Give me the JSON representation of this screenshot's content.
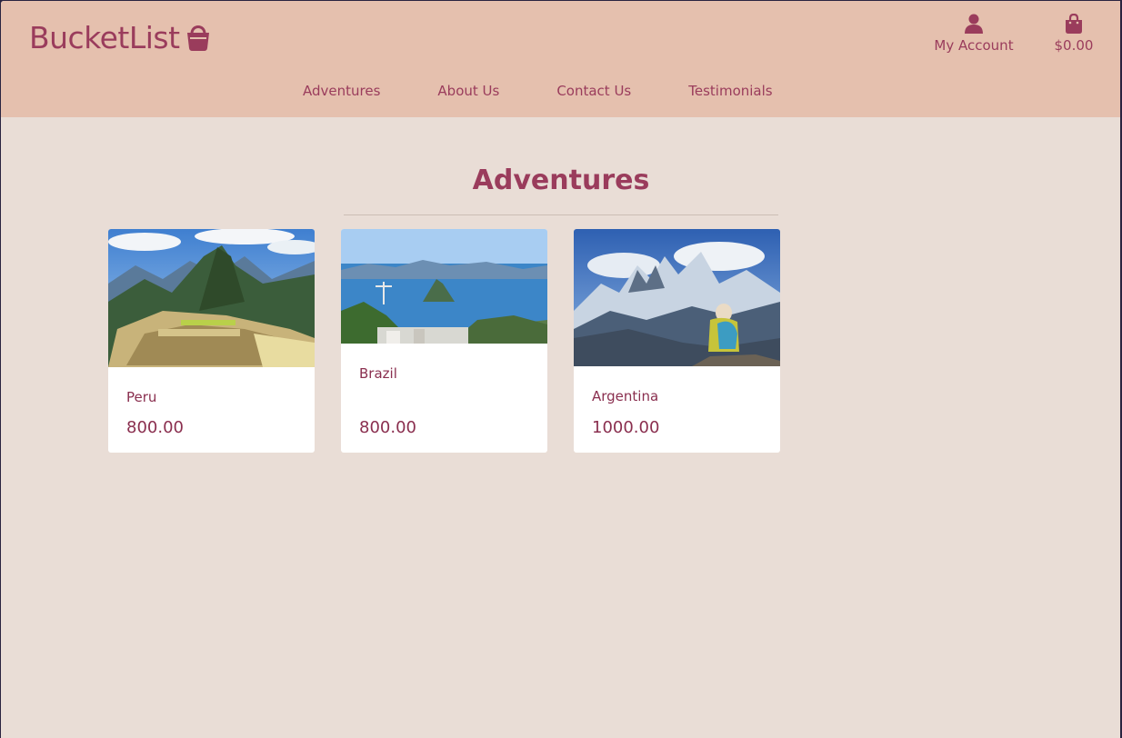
{
  "brand": {
    "name": "BucketList",
    "icon": "basket-icon",
    "color": "#9a3c5c"
  },
  "header": {
    "account": {
      "label": "My Account",
      "icon": "user-icon"
    },
    "bag": {
      "label": "$0.00",
      "icon": "shopping-bag-icon"
    },
    "background": "#e5c0ae"
  },
  "nav": {
    "items": [
      {
        "label": "Adventures"
      },
      {
        "label": "About Us"
      },
      {
        "label": "Contact Us"
      },
      {
        "label": "Testimonials"
      }
    ]
  },
  "main": {
    "title": "Adventures",
    "background": "#e9ddd6",
    "products": [
      {
        "name": "Peru",
        "price": "800.00",
        "image": "machu-picchu-photo"
      },
      {
        "name": "Brazil",
        "price": "800.00",
        "image": "rio-de-janeiro-photo"
      },
      {
        "name": "Argentina",
        "price": "1000.00",
        "image": "patagonia-hiker-photo"
      }
    ]
  }
}
